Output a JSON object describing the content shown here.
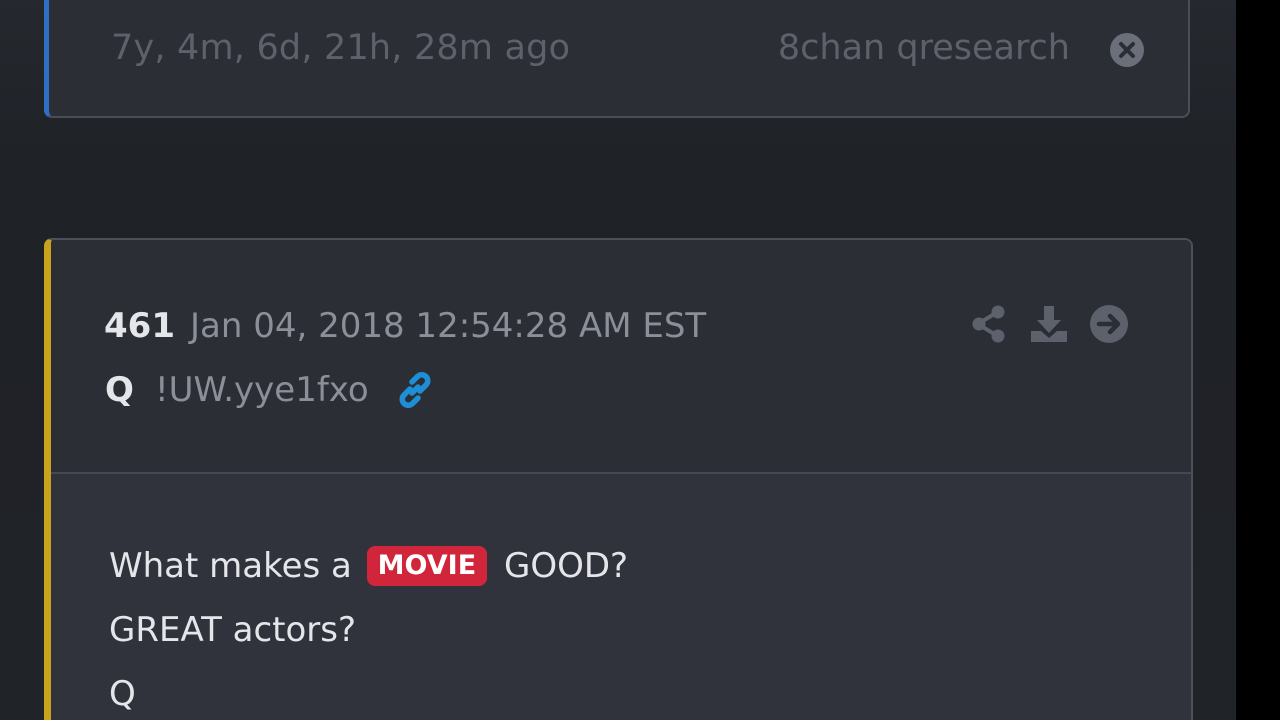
{
  "previous_post": {
    "time_ago": "7y, 4m, 6d, 21h, 28m ago",
    "source": "8chan qresearch",
    "close_icon": "close-circle-icon",
    "accent_color": "#2f6fc4"
  },
  "post": {
    "number": "461",
    "date": "Jan 04, 2018 12:54:28 AM EST",
    "author": "Q",
    "tripcode": "!UW.yye1fxo",
    "accent_color": "#c9a31c",
    "link_color": "#1e8fd6",
    "actions": [
      "share-icon",
      "download-icon",
      "arrow-right-circle-icon"
    ],
    "body": {
      "line1_before": "What makes a",
      "line1_tag": "MOVIE",
      "line1_after": "GOOD?",
      "line2": "GREAT actors?",
      "line3": "Q"
    },
    "tag_color": "#d0253a"
  }
}
